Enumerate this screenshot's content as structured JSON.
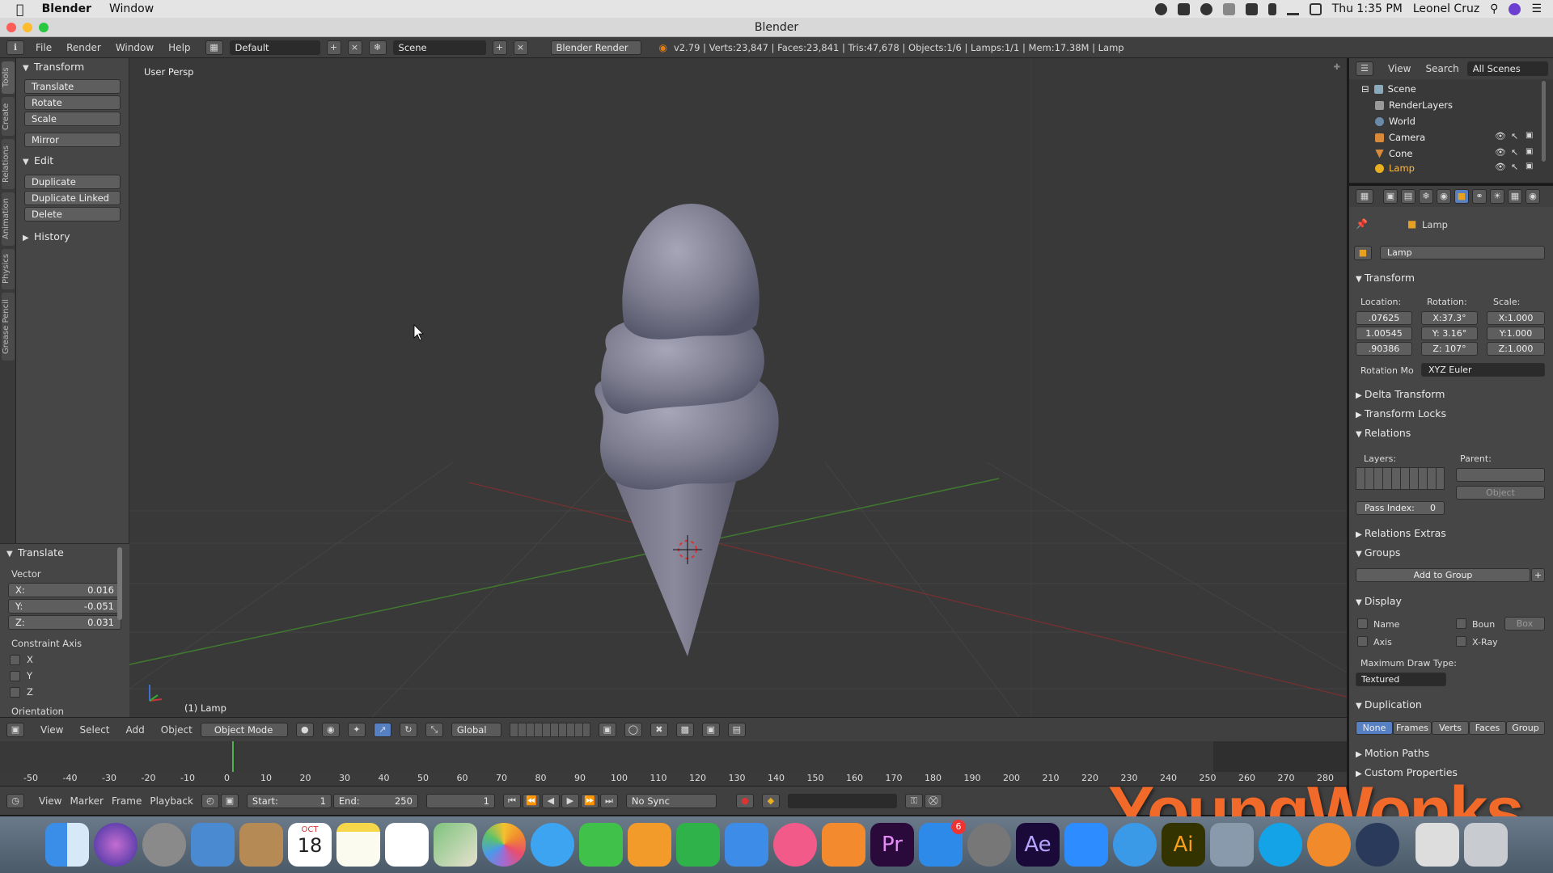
{
  "menubar": {
    "app": "Blender",
    "items": [
      "Window"
    ],
    "clock": "Thu 1:35 PM",
    "user": "Leonel Cruz"
  },
  "window": {
    "title": "Blender"
  },
  "info_header": {
    "menus": [
      "File",
      "Render",
      "Window",
      "Help"
    ],
    "layout": "Default",
    "scene": "Scene",
    "engine": "Blender Render",
    "stats": "v2.79 | Verts:23,847 | Faces:23,841 | Tris:47,678 | Objects:1/6 | Lamps:1/1 | Mem:17.38M | Lamp"
  },
  "left_tabs": [
    "Tools",
    "Create",
    "Relations",
    "Animation",
    "Physics",
    "Grease Pencil"
  ],
  "toolshelf": {
    "transform_title": "Transform",
    "transform_buttons": [
      "Translate",
      "Rotate",
      "Scale"
    ],
    "mirror": "Mirror",
    "edit_title": "Edit",
    "edit_buttons": [
      "Duplicate",
      "Duplicate Linked",
      "Delete"
    ],
    "history_title": "History"
  },
  "redo": {
    "title": "Translate",
    "vector_label": "Vector",
    "x_label": "X:",
    "x": "0.016",
    "y_label": "Y:",
    "y": "-0.051",
    "z_label": "Z:",
    "z": "0.031",
    "constraint_label": "Constraint Axis",
    "axes": [
      "X",
      "Y",
      "Z"
    ],
    "orientation": "Orientation"
  },
  "viewport": {
    "view_label": "User Persp",
    "object_label": "(1) Lamp"
  },
  "viewport_header": {
    "menus": [
      "View",
      "Select",
      "Add",
      "Object"
    ],
    "mode": "Object Mode",
    "orientation": "Global"
  },
  "timeline": {
    "ticks": [
      "-50",
      "-40",
      "-30",
      "-20",
      "-10",
      "0",
      "10",
      "20",
      "30",
      "40",
      "50",
      "60",
      "70",
      "80",
      "90",
      "100",
      "110",
      "120",
      "130",
      "140",
      "150",
      "160",
      "170",
      "180",
      "190",
      "200",
      "210",
      "220",
      "230",
      "240",
      "250",
      "260",
      "270",
      "280"
    ],
    "menus": [
      "View",
      "Marker",
      "Frame",
      "Playback"
    ],
    "start_label": "Start:",
    "start": "1",
    "end_label": "End:",
    "end": "250",
    "current": "1",
    "sync": "No Sync"
  },
  "outliner": {
    "menus": [
      "View",
      "Search"
    ],
    "filter": "All Scenes",
    "rows": [
      "Scene",
      "RenderLayers",
      "World",
      "Camera",
      "Cone",
      "Lamp"
    ]
  },
  "properties": {
    "breadcrumb": "Lamp",
    "object_name": "Lamp",
    "transform_title": "Transform",
    "location_label": "Location:",
    "rotation_label": "Rotation:",
    "scale_label": "Scale:",
    "location": [
      ".07625",
      "1.00545",
      ".90386"
    ],
    "rotation": [
      "X:37.3°",
      "Y: 3.16°",
      "Z: 107°"
    ],
    "scale": [
      "X:1.000",
      "Y:1.000",
      "Z:1.000"
    ],
    "rotation_mode_label": "Rotation Mo",
    "rotation_mode": "XYZ Euler",
    "delta": "Delta Transform",
    "locks": "Transform Locks",
    "relations": "Relations",
    "layers_label": "Layers:",
    "parent_label": "Parent:",
    "parent_type": "Object",
    "pass_index_label": "Pass Index:",
    "pass_index": "0",
    "relations_extras": "Relations Extras",
    "groups": "Groups",
    "add_group": "Add to Group",
    "display": "Display",
    "name_opt": "Name",
    "axis_opt": "Axis",
    "bounds_opt": "Boun",
    "bounds_type": "Box",
    "xray_opt": "X-Ray",
    "max_draw_label": "Maximum Draw Type:",
    "max_draw": "Textured",
    "duplication": "Duplication",
    "dup_options": [
      "None",
      "Frames",
      "Verts",
      "Faces",
      "Group"
    ],
    "motion_paths": "Motion Paths",
    "custom_props": "Custom Properties"
  },
  "dock": {
    "calendar_month": "OCT",
    "calendar_day": "18",
    "appstore_badge": "6",
    "pr": "Pr",
    "ae": "Ae",
    "ai": "Ai"
  },
  "watermark": "YoungWonks"
}
